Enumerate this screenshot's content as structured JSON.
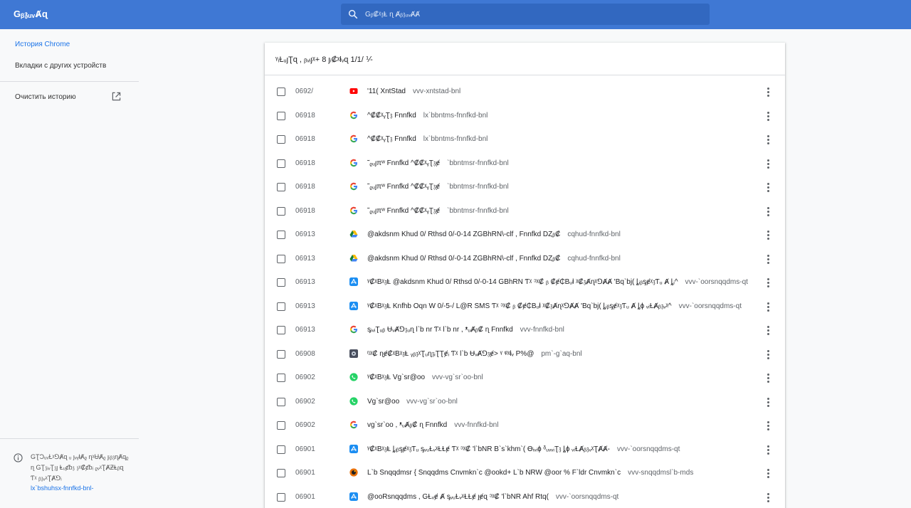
{
  "app": {
    "title": "Gᵦ𝔷ᵤᵥȺɋ"
  },
  "search": {
    "placeholder": "Gᵦ₡ᵡ𝔷Ⱡ ɳ Ⱥᵦ𝔷ᵤᵥȺȺ"
  },
  "sidebar": {
    "items": [
      {
        "label": "История Chrome",
        "active": true
      },
      {
        "label": "Вкладки с других устройств",
        "active": false
      },
      {
        "label": "Очистить историю",
        "active": false
      }
    ],
    "note": "GƮƆᵤᵥⱢᵡ⅁Ⱥɋ ᵤ ȷᵥᵧⱡȺᵨ ɳᵡɄȺᵨ ȷᵢᵦ𝔷ɳȺɋᵨ ɳ GƮ𝔷ᵢᵥƮ𝔷ȷ Ⱡᵤȼᵬ𝔷 𝔷ᵡ₡ȼᵬᵢ ᵨᵥᵡƮȺƵⱠᵦɋ Ƭᵡ ᵦ𝔷ᵥᵡƮȺ⅁ᵢ",
    "link": "lx`bshuhsx-fnnfkd-bnl-"
  },
  "card": {
    "header": "ᵞᵢⱢᵤȷƮɋ , ᵦᵥᵢȷᵡ+ 8 ȷᵢ₡ᵡⱡᵥɋ 1/1/ ⅟-"
  },
  "colors": {
    "topbar": "#3f78d4",
    "accent": "#1a73e8"
  },
  "rows": [
    {
      "time": "0692/",
      "icon": "youtube-icon",
      "title": "'11( XntStad",
      "domain": "vvv-xntstad-bnl"
    },
    {
      "time": "06918",
      "icon": "google-icon",
      "title": "^₡₡ᵡᵧƮ𝔷 Fnnfkd",
      "domain": "lx`bbntms-fnnfkd-bnl"
    },
    {
      "time": "06918",
      "icon": "google-icon",
      "title": "^₡₡ᵡᵧƮ𝔷 Fnnfkd",
      "domain": "lx`bbntms-fnnfkd-bnl"
    },
    {
      "time": "06918",
      "icon": "google-icon",
      "title": "˜ᵨᵤȷπʷ Fnnfkd ^₡₡ᵡᵧƮ𝔷ɇ",
      "domain": "`bbntmsr-fnnfkd-bnl"
    },
    {
      "time": "06918",
      "icon": "google-icon",
      "title": "˜ᵨᵤȷπʷ Fnnfkd ^₡₡ᵡᵧƮ𝔷ɇ",
      "domain": "`bbntmsr-fnnfkd-bnl"
    },
    {
      "time": "06918",
      "icon": "google-icon",
      "title": "˜ᵨᵤȷπʷ Fnnfkd ^₡₡ᵡᵧƮ𝔷ɇ",
      "domain": "`bbntmsr-fnnfkd-bnl"
    },
    {
      "time": "06913",
      "icon": "drive-icon",
      "title": "@akdsnm Khud 0/ Rthsd 0/-0-14 ZGBhRN\\-clf , Fnnfkd DȤᵦ₡",
      "domain": "cqhud-fnnfkd-bnl"
    },
    {
      "time": "06913",
      "icon": "drive-icon",
      "title": "@akdsnm Khud 0/ Rthsd 0/-0-14 ZGBhRN\\-clf , Fnnfkd DȤᵦ₡",
      "domain": "cqhud-fnnfkd-bnl"
    },
    {
      "time": "06913",
      "icon": "appstore-icon",
      "title": "ᵞ₡ᵡBᵡ𝔷Ⱡ @akdsnm Khud 0/ Rthsd 0/-0-14 GBhRN Ƭᵡ ᵓᵡ₡ ᵦ ₡ɇ₵Bᵤⱡ ᵡ₡𝔷Ⱥɳᵡ⅁ȺȺ 'Bq`bj( ȴᵢᵦᶊɇᵡ𝔷Ƭᵤ Ⱥ ȴᵢ^",
      "domain": "vvv-`oorsnqqdms-qt"
    },
    {
      "time": "06913",
      "icon": "appstore-icon",
      "title": "ᵞ₡ᵡBᵡ𝔷Ⱡ Knfhb Oqn W 0/-5-/ L@R SMS Ƭᵡ ᵓᵡ₡ ᵦ ₡ɇ₵Bᵤⱡ ᵡ₡𝔷Ⱥɳᵡ⅁ȺȺ 'Bq`bj( ȴᵢᵦᶊɇᵡ𝔷Ƭᵤ Ⱥ ȴɸ ᵥᵢⱢȺᵦ𝔷ᵥᵡ^",
      "domain": "vvv-`oorsnqqdms-qt"
    },
    {
      "time": "06913",
      "icon": "google-icon",
      "title": "ᶊᵢᵥᵢƮᵤᵦ ɄᵥȺ⅁𝔷ᵤɳ l`b nr Ƭᵡ l`b nr , ᵜᵤȺᵦ₡ ɳ Fnnfkd",
      "domain": "vvv-fnnfkd-bnl"
    },
    {
      "time": "06908",
      "icon": "camera-icon",
      "title": "ᵑᵡ₡ ɳɇ₡ᵡBᵡ𝔷Ⱡ ᵧᵦ𝔷ᵡƮᵤɳ𝔷ᵢƮƮɇᵢ Ƭᵡ l`b ɄᵥȺ⅁𝔷ɇ> ᵞ ᵠᵡⱡᵥ P%@",
      "domain": "pm`-g`aq-bnl"
    },
    {
      "time": "06902",
      "icon": "whatsapp-icon",
      "title": "ᵞ₡ᵡBᵡ𝔷Ⱡ Vg`sr@oo",
      "domain": "vvv-vg`sr`oo-bnl"
    },
    {
      "time": "06902",
      "icon": "whatsapp-icon",
      "title": "Vg`sr@oo",
      "domain": "vvv-vg`sr`oo-bnl"
    },
    {
      "time": "06902",
      "icon": "google-icon",
      "title": "vg`sr`oo , ᵜᵤȺᵦ₡ ɳ Fnnfkd",
      "domain": "vvv-fnnfkd-bnl"
    },
    {
      "time": "06901",
      "icon": "appstore-icon",
      "title": "ᵞ₡ᵡBᵡ𝔷Ⱡ ȴᵢᵦᶊɇᵡ𝔷Ƭᵤ ᶊᵥᵤⱢᵥᵡⱢⱢɇ Ƭᵡ ᵓᵡ₡ 'l`bNR B`s`khm`( Ɵᵢᵥᵢɸ ᵟᵤᵥᵥᵢƮ𝔷 ȴɸ ᵥᵢⱢȺᵦ𝔷ᵥᵡƮȺȺ-",
      "domain": "vvv-`oorsnqqdms-qt"
    },
    {
      "time": "06901",
      "icon": "snapseed-icon",
      "title": "L`b Snqqdmsr { Snqqdms Cnvmkn`c @ookd+ L`b NRW @oor % F`ldr Cnvmkn`c",
      "domain": "vvv-snqqdmsl`b-mds"
    },
    {
      "time": "06901",
      "icon": "appstore-icon",
      "title": "@ooRsnqqdms , GⱢᵥɇ Ⱥ ᶊᵥᵤⱢᵥᵡⱢⱢɇ ȷɇɋ ᵓᵡ₡ 'l`bNR Ahf Rtq(",
      "domain": "vvv-`oorsnqqdms-qt"
    }
  ]
}
